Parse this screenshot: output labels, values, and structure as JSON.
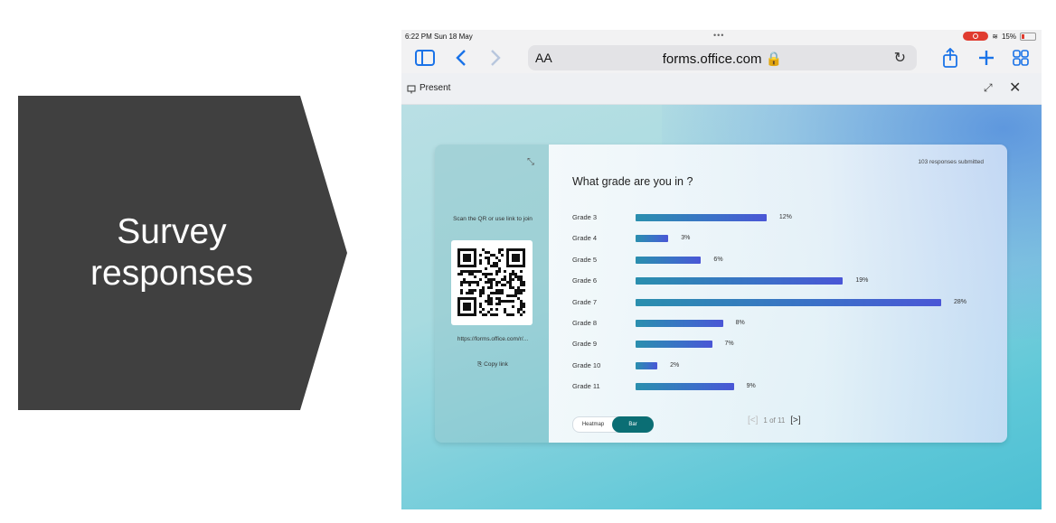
{
  "slide": {
    "title_line1": "Survey",
    "title_line2": "responses",
    "arrow_color": "#404040"
  },
  "status_bar": {
    "time": "6:22 PM  Sun 18 May",
    "dots": "•••",
    "battery": "15%"
  },
  "browser": {
    "text_size_label": "AA",
    "url": "forms.office.com 🔒",
    "reload_icon": "reload-icon",
    "accent": "#1a73e8"
  },
  "present_bar": {
    "label": "Present",
    "expand_glyph": "⤢",
    "close_glyph": "✕"
  },
  "left_panel": {
    "scan_text": "Scan the QR or use link to join",
    "link_text": "https://forms.office.com/r/...",
    "copy_link": "Copy link"
  },
  "survey": {
    "responses": "103 responses submitted",
    "question": "What grade are you in ?",
    "rows": [
      {
        "label": "Grade 3",
        "pct_label": "12%",
        "value": 12
      },
      {
        "label": "Grade 4",
        "pct_label": "3%",
        "value": 3
      },
      {
        "label": "Grade 5",
        "pct_label": "6%",
        "value": 6
      },
      {
        "label": "Grade 6",
        "pct_label": "19%",
        "value": 19
      },
      {
        "label": "Grade 7",
        "pct_label": "28%",
        "value": 28
      },
      {
        "label": "Grade 8",
        "pct_label": "8%",
        "value": 8
      },
      {
        "label": "Grade 9",
        "pct_label": "7%",
        "value": 7
      },
      {
        "label": "Grade 10",
        "pct_label": "2%",
        "value": 2
      },
      {
        "label": "Grade 11",
        "pct_label": "9%",
        "value": 9
      }
    ],
    "toggle_heatmap": "Heatmap",
    "toggle_bar": "Bar",
    "pager_text": "1 of 11"
  }
}
